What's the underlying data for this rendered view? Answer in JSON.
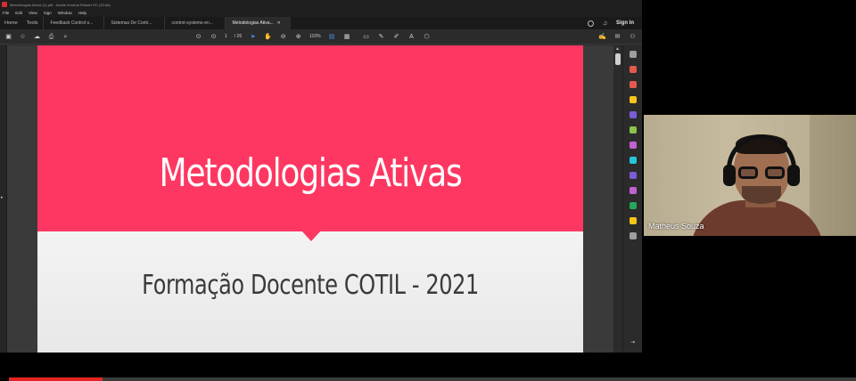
{
  "window": {
    "title": "Metodologias Ativas (1).pdf - Adobe Acrobat Reader DC (32-bit)"
  },
  "menu": [
    "File",
    "Edit",
    "View",
    "Sign",
    "Window",
    "Help"
  ],
  "nav_tabs": [
    "Home",
    "Tools"
  ],
  "doc_tabs": [
    {
      "label": "Feedback Control o...",
      "active": false
    },
    {
      "label": "Sistemas De Contr...",
      "active": false
    },
    {
      "label": "control-systems-en...",
      "active": false
    },
    {
      "label": "Metodologias Ativa...",
      "active": true
    }
  ],
  "header": {
    "sign_in": "Sign In"
  },
  "toolbar": {
    "page_current": "1",
    "page_total": "/ 26",
    "zoom": "110%"
  },
  "slide": {
    "title": "Metodologias Ativas",
    "subtitle": "Formação Docente COTIL - 2021"
  },
  "colors": {
    "slide_accent": "#fd3761",
    "slide_bottom": "#efefef",
    "viewer_bg": "#2b2b2b",
    "progress": "#e22424"
  },
  "right_tools": [
    {
      "icon": "search-zoom-icon",
      "color": "#9e9e9e"
    },
    {
      "icon": "export-pdf-icon",
      "color": "#e5584e"
    },
    {
      "icon": "create-pdf-icon",
      "color": "#e5584e"
    },
    {
      "icon": "comment-icon",
      "color": "#f5c518"
    },
    {
      "icon": "combine-files-icon",
      "color": "#7b5cd6"
    },
    {
      "icon": "edit-pdf-icon",
      "color": "#8bc34a"
    },
    {
      "icon": "fill-sign-icon",
      "color": "#c062d1"
    },
    {
      "icon": "scan-ocr-icon",
      "color": "#26c6da"
    },
    {
      "icon": "protect-icon",
      "color": "#7b5cd6"
    },
    {
      "icon": "send-signature-icon",
      "color": "#c062d1"
    },
    {
      "icon": "organize-pages-icon",
      "color": "#26a65b"
    },
    {
      "icon": "compress-icon",
      "color": "#f5c518"
    },
    {
      "icon": "more-tools-icon",
      "color": "#9e9e9e"
    }
  ],
  "webcam": {
    "participant_name": "Matheus Souza"
  },
  "video": {
    "progress_fraction": 0.11
  }
}
